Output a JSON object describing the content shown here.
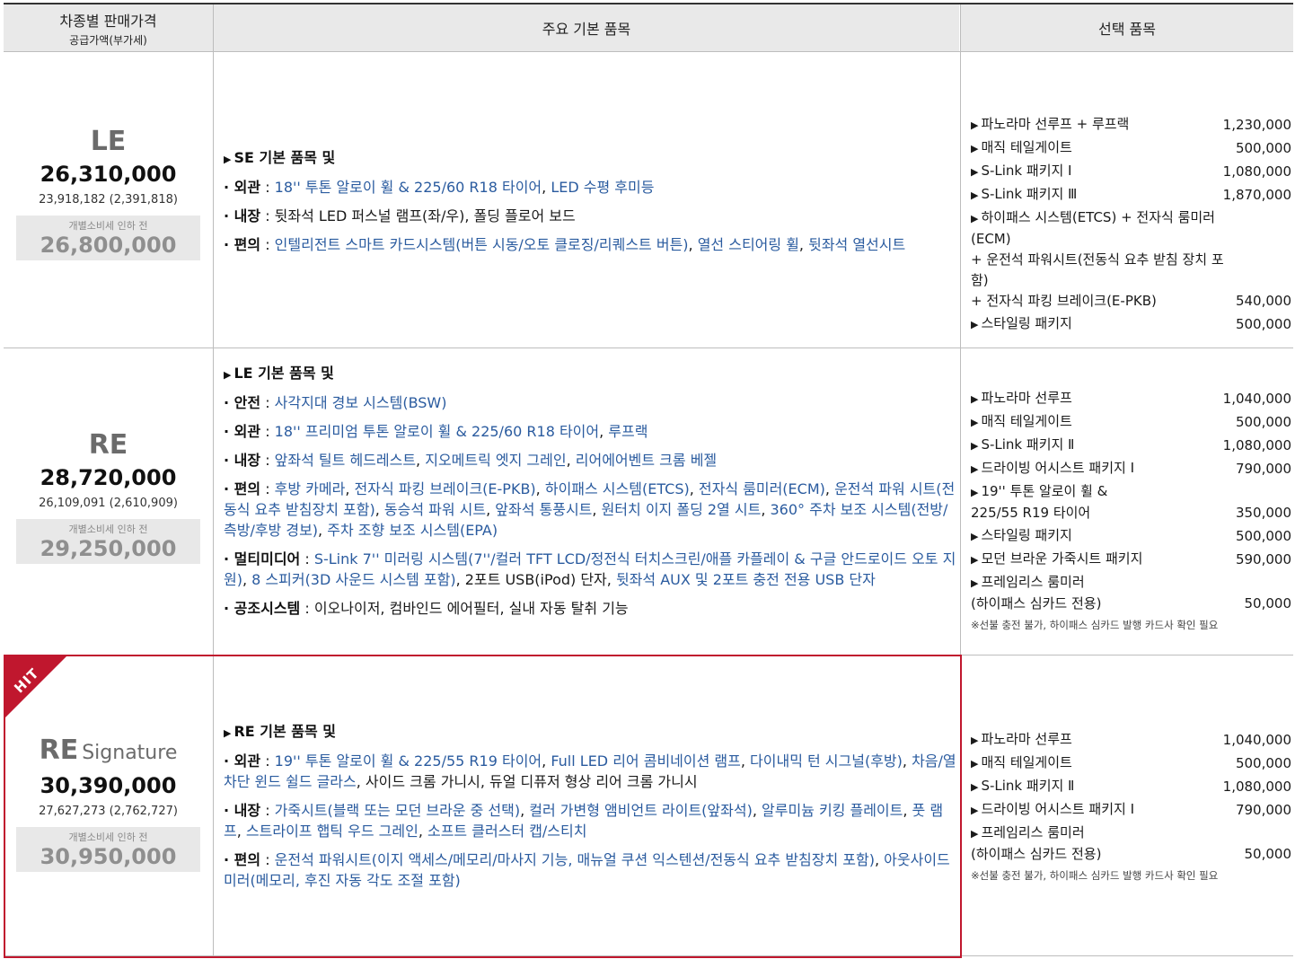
{
  "header": {
    "col1_title": "차종별 판매가격",
    "col1_sub": "공급가액(부가세)",
    "col2_title": "주요 기본 품목",
    "col3_title": "선택 품목"
  },
  "pre_label": "개별소비세 인하 전",
  "hit_badge": "HIT",
  "rows": [
    {
      "model": "LE",
      "price": "26,310,000",
      "supply": "23,918,182 (2,391,818)",
      "pre_price": "26,800,000",
      "features_head": "SE 기본 품목 및",
      "features": [
        {
          "cat": "외관",
          "parts": [
            {
              "t": "18'' 투톤 알로이 휠 & 225/60 R18 타이어",
              "c": "bl"
            },
            {
              "t": ", ",
              "c": "bk"
            },
            {
              "t": "LED 수평 후미등",
              "c": "bl"
            }
          ]
        },
        {
          "cat": "내장",
          "parts": [
            {
              "t": "뒷좌석 LED 퍼스널 램프(좌/우), 폴딩 플로어 보드",
              "c": "bk"
            }
          ]
        },
        {
          "cat": "편의",
          "parts": [
            {
              "t": "인텔리전트 스마트 카드시스템(버튼 시동/오토 클로징/리퀘스트 버튼)",
              "c": "bl"
            },
            {
              "t": ", ",
              "c": "bk"
            },
            {
              "t": "열선 스티어링 휠",
              "c": "bl"
            },
            {
              "t": ", ",
              "c": "bk"
            },
            {
              "t": "뒷좌석 열선시트",
              "c": "bl"
            }
          ]
        }
      ],
      "options": [
        {
          "name": "파노라마 선루프 + 루프랙",
          "price": "1,230,000"
        },
        {
          "name": "매직 테일게이트",
          "price": "500,000"
        },
        {
          "name": "S-Link 패키지 Ⅰ",
          "price": "1,080,000"
        },
        {
          "name": "S-Link 패키지 Ⅲ",
          "price": "1,870,000"
        },
        {
          "name": "하이패스 시스템(ETCS) + 전자식 룸미러(ECM)\n + 운전석 파워시트(전동식 요추 받침 장치 포함)\n + 전자식 파킹 브레이크(E-PKB)",
          "price": "540,000"
        },
        {
          "name": "스타일링 패키지",
          "price": "500,000"
        }
      ],
      "note": ""
    },
    {
      "model": "RE",
      "price": "28,720,000",
      "supply": "26,109,091 (2,610,909)",
      "pre_price": "29,250,000",
      "features_head": "LE 기본 품목 및",
      "features": [
        {
          "cat": "안전",
          "parts": [
            {
              "t": "사각지대 경보 시스템(BSW)",
              "c": "bl"
            }
          ]
        },
        {
          "cat": "외관",
          "parts": [
            {
              "t": "18'' 프리미엄 투톤 알로이 휠 & 225/60 R18 타이어",
              "c": "bl"
            },
            {
              "t": ", ",
              "c": "bk"
            },
            {
              "t": "루프랙",
              "c": "bl"
            }
          ]
        },
        {
          "cat": "내장",
          "parts": [
            {
              "t": "앞좌석 틸트 헤드레스트",
              "c": "bl"
            },
            {
              "t": ", ",
              "c": "bk"
            },
            {
              "t": "지오메트릭 엣지 그레인",
              "c": "bl"
            },
            {
              "t": ", ",
              "c": "bk"
            },
            {
              "t": "리어에어벤트 크롬 베젤",
              "c": "bl"
            }
          ]
        },
        {
          "cat": "편의",
          "parts": [
            {
              "t": "후방 카메라",
              "c": "bl"
            },
            {
              "t": ", ",
              "c": "bk"
            },
            {
              "t": "전자식 파킹 브레이크(E-PKB)",
              "c": "bl"
            },
            {
              "t": ", ",
              "c": "bk"
            },
            {
              "t": "하이패스 시스템(ETCS)",
              "c": "bl"
            },
            {
              "t": ", ",
              "c": "bk"
            },
            {
              "t": "전자식 룸미러(ECM)",
              "c": "bl"
            },
            {
              "t": ", ",
              "c": "bk"
            },
            {
              "t": "운전석 파워 시트(전동식 요추 받침장치 포함)",
              "c": "bl"
            },
            {
              "t": ", ",
              "c": "bk"
            },
            {
              "t": "동승석 파워 시트",
              "c": "bl"
            },
            {
              "t": ", ",
              "c": "bk"
            },
            {
              "t": "앞좌석 통풍시트",
              "c": "bl"
            },
            {
              "t": ", ",
              "c": "bk"
            },
            {
              "t": "원터치 이지 폴딩 2열 시트",
              "c": "bl"
            },
            {
              "t": ", ",
              "c": "bk"
            },
            {
              "t": "360° 주차 보조 시스템(전방/측방/후방 경보)",
              "c": "bl"
            },
            {
              "t": ", ",
              "c": "bk"
            },
            {
              "t": "주차 조향 보조 시스템(EPA)",
              "c": "bl"
            }
          ]
        },
        {
          "cat": "멀티미디어",
          "parts": [
            {
              "t": "S-Link 7'' 미러링 시스템(7''/컬러 TFT LCD/정전식 터치스크린/애플 카플레이 & 구글 안드로이드 오토 지원)",
              "c": "bl"
            },
            {
              "t": ", ",
              "c": "bk"
            },
            {
              "t": "8 스피커(3D 사운드 시스템 포함)",
              "c": "bl"
            },
            {
              "t": ", 2포트 USB(iPod) 단자, ",
              "c": "bk"
            },
            {
              "t": "뒷좌석 AUX 및 2포트 충전 전용 USB 단자",
              "c": "bl"
            }
          ]
        },
        {
          "cat": "공조시스템",
          "parts": [
            {
              "t": "이오나이저, 컴바인드 에어필터, 실내 자동 탈취 기능",
              "c": "bk"
            }
          ]
        }
      ],
      "options": [
        {
          "name": "파노라마 선루프",
          "price": "1,040,000"
        },
        {
          "name": "매직 테일게이트",
          "price": "500,000"
        },
        {
          "name": "S-Link 패키지 Ⅱ",
          "price": "1,080,000"
        },
        {
          "name": "드라이빙 어시스트 패키지 Ⅰ",
          "price": "790,000"
        },
        {
          "name": "19'' 투톤 알로이 휠 &\n 225/55 R19 타이어",
          "price": "350,000"
        },
        {
          "name": "스타일링 패키지",
          "price": "500,000"
        },
        {
          "name": "모던 브라운 가죽시트 패키지",
          "price": "590,000"
        },
        {
          "name": "프레임리스 룸미러\n (하이패스 심카드 전용)",
          "price": "50,000"
        }
      ],
      "note": "※선불 충전 불가, 하이패스 심카드 발행 카드사 확인 필요"
    },
    {
      "model": "RE",
      "model_suffix": "Signature",
      "price": "30,390,000",
      "supply": "27,627,273 (2,762,727)",
      "pre_price": "30,950,000",
      "features_head": "RE 기본 품목 및",
      "features": [
        {
          "cat": "외관",
          "parts": [
            {
              "t": "19'' 투톤 알로이 휠 & 225/55 R19 타이어",
              "c": "bl"
            },
            {
              "t": ", ",
              "c": "bk"
            },
            {
              "t": "Full LED 리어 콤비네이션 램프",
              "c": "bl"
            },
            {
              "t": ", ",
              "c": "bk"
            },
            {
              "t": "다이내믹 턴 시그널(후방)",
              "c": "bl"
            },
            {
              "t": ", ",
              "c": "bk"
            },
            {
              "t": "차음/열차단 윈드 쉴드 글라스",
              "c": "bl"
            },
            {
              "t": ", 사이드 크롬 가니시, 듀얼 디퓨저 형상 리어 크롬 가니시",
              "c": "bk"
            }
          ]
        },
        {
          "cat": "내장",
          "parts": [
            {
              "t": "가죽시트(블랙 또는 모던 브라운 중 선택)",
              "c": "bl"
            },
            {
              "t": ", ",
              "c": "bk"
            },
            {
              "t": "컬러 가변형 앰비언트 라이트(앞좌석)",
              "c": "bl"
            },
            {
              "t": ", ",
              "c": "bk"
            },
            {
              "t": "알루미늄 키킹 플레이트",
              "c": "bl"
            },
            {
              "t": ", ",
              "c": "bk"
            },
            {
              "t": "풋 램프",
              "c": "bl"
            },
            {
              "t": ", ",
              "c": "bk"
            },
            {
              "t": "스트라이프 햅틱 우드 그레인",
              "c": "bl"
            },
            {
              "t": ", ",
              "c": "bk"
            },
            {
              "t": "소프트 클러스터 캡/스티치",
              "c": "bl"
            }
          ]
        },
        {
          "cat": "편의",
          "parts": [
            {
              "t": "운전석 파워시트(이지 액세스/메모리/마사지 기능, 매뉴얼 쿠션 익스텐션/전동식 요추 받침장치 포함)",
              "c": "bl"
            },
            {
              "t": ", ",
              "c": "bk"
            },
            {
              "t": "아웃사이드 미러(메모리, 후진 자동 각도 조절 포함)",
              "c": "bl"
            }
          ]
        }
      ],
      "options": [
        {
          "name": "파노라마 선루프",
          "price": "1,040,000"
        },
        {
          "name": "매직 테일게이트",
          "price": "500,000"
        },
        {
          "name": "S-Link 패키지 Ⅱ",
          "price": "1,080,000"
        },
        {
          "name": "드라이빙 어시스트 패키지 Ⅰ",
          "price": "790,000"
        },
        {
          "name": "프레임리스 룸미러\n (하이패스 심카드 전용)",
          "price": "50,000"
        }
      ],
      "note": "※선불 충전 불가, 하이패스 심카드 발행 카드사 확인 필요"
    }
  ]
}
